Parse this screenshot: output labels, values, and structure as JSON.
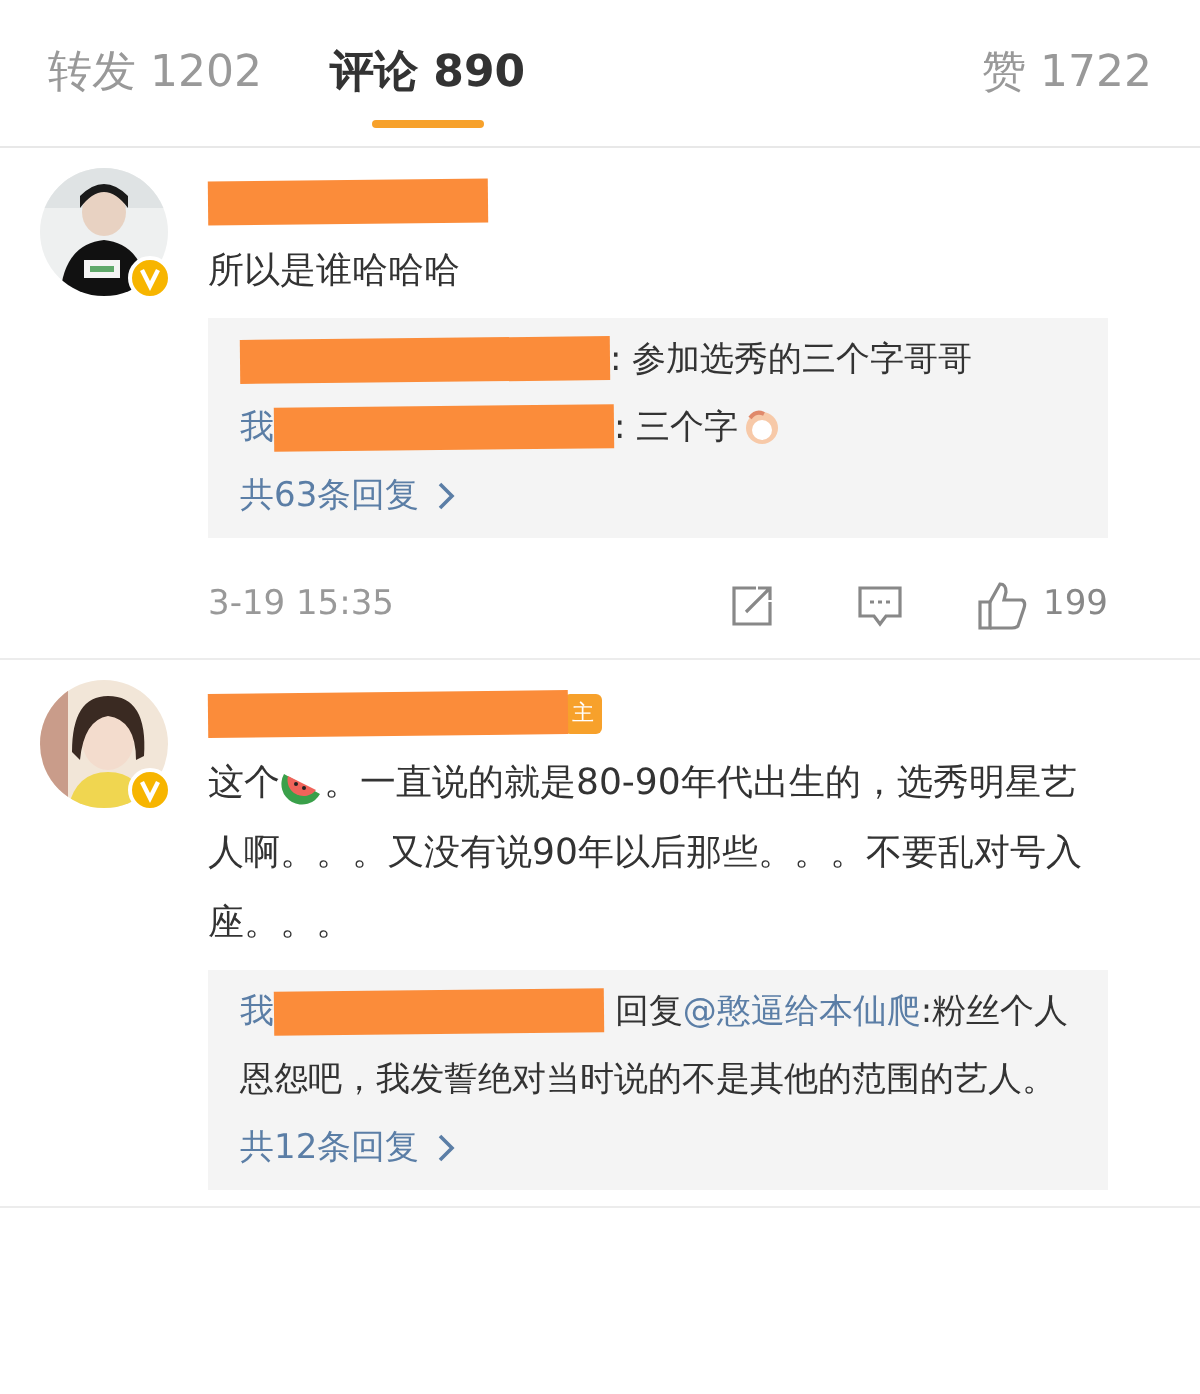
{
  "tabs": [
    {
      "label": "转发 1202",
      "selected": false
    },
    {
      "label": "评论 890",
      "selected": true
    },
    {
      "label": "赞 1722",
      "selected": false
    }
  ],
  "comments": [
    {
      "avatar": {
        "kind": "picture"
      },
      "segments": [
        {
          "kind": "text",
          "text": "所以是谁哈哈哈"
        }
      ],
      "replies": [
        {
          "content": ": 参加选秀的三个字哥哥"
        },
        {
          "name": "我",
          "content": ": 三个字",
          "emoji": true
        }
      ],
      "more": "共63条回复",
      "time": "3-19 15:35",
      "likes": "199"
    },
    {
      "avatar": {
        "kind": "picture"
      },
      "badge": "主",
      "segments": [
        {
          "kind": "text",
          "text": "这个"
        },
        {
          "kind": "watermelon"
        },
        {
          "kind": "text",
          "text": "。一直说的就是80-90年代出生的，选秀明星艺人啊。。。又没有说90年以后那些。。。不要乱对号入座。。。"
        }
      ],
      "replies": [
        {
          "name": "我",
          "reply_word": "回复",
          "mention": "@憨逼给本仙爬",
          "content": ":粉丝个人恩怨吧，我发誓绝对当时说的不是其他的范围的艺人。"
        }
      ],
      "more": "共12条回复"
    }
  ]
}
